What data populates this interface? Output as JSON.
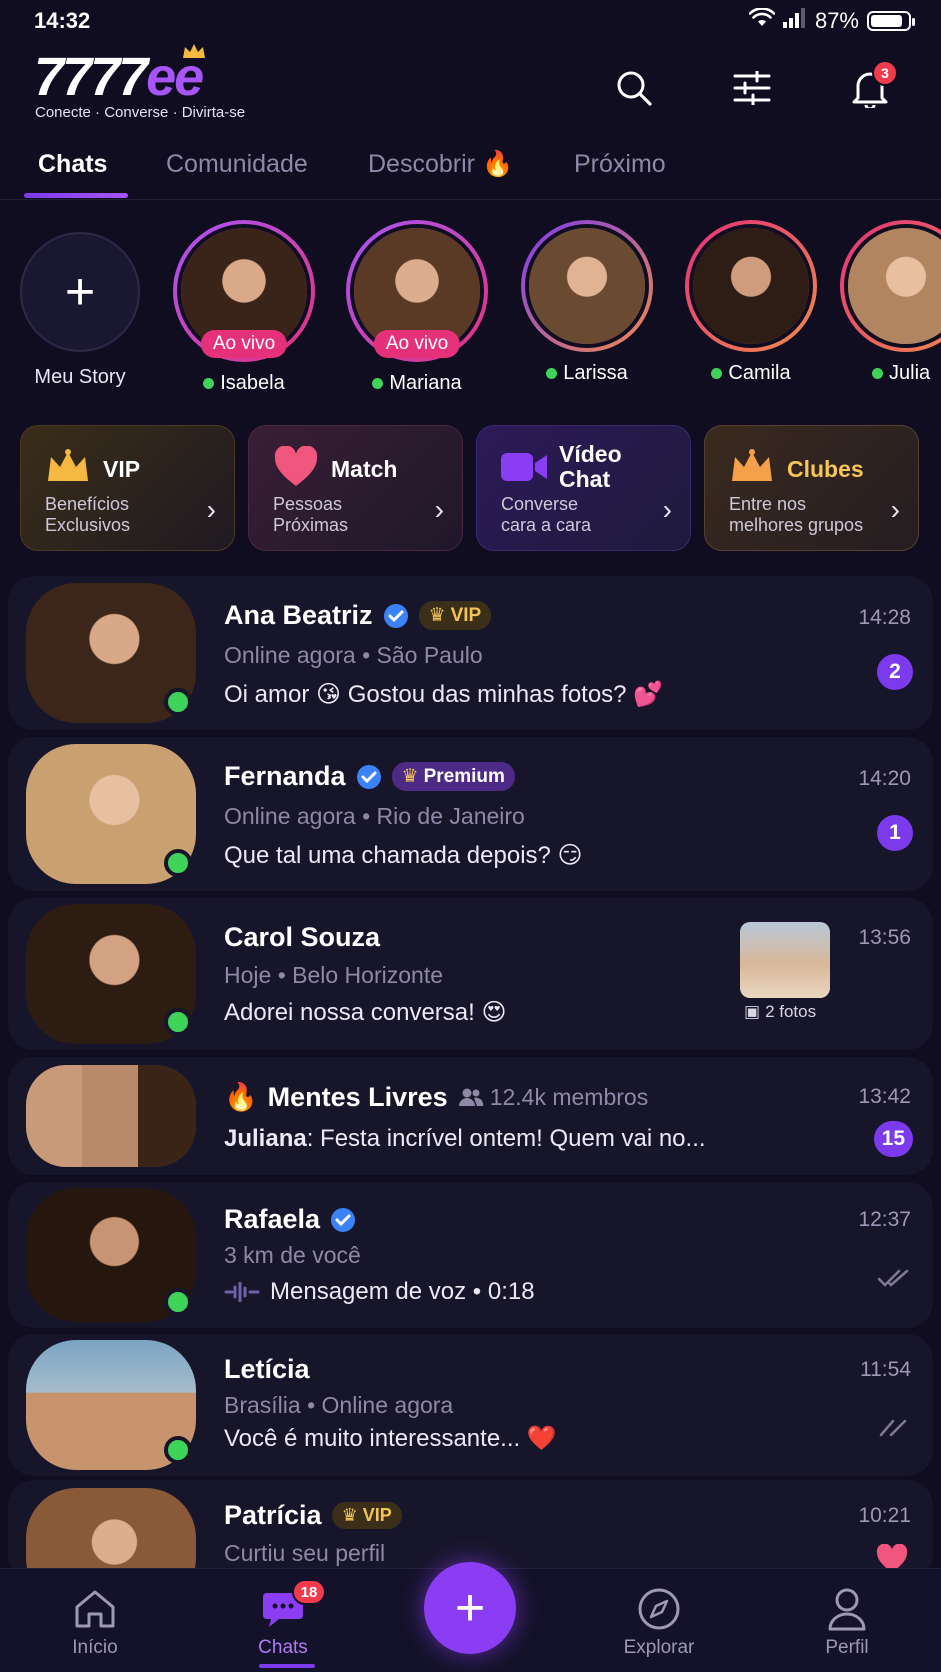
{
  "status": {
    "time": "14:32",
    "battery": "87%",
    "battery_level": 0.87
  },
  "header": {
    "logo_num": "7777",
    "logo_ee": "ee",
    "tagline": "Conecte · Converse · Divirta-se",
    "notification_count": "3"
  },
  "tabs": [
    {
      "label": "Chats"
    },
    {
      "label": "Comunidade"
    },
    {
      "label": "Descobrir"
    },
    {
      "label": "Próximo"
    }
  ],
  "stories": {
    "my_story_label": "Meu Story",
    "live_label": "Ao vivo",
    "items": [
      {
        "name": "Isabela"
      },
      {
        "name": "Mariana"
      },
      {
        "name": "Larissa"
      },
      {
        "name": "Camila"
      },
      {
        "name": "Julia"
      }
    ]
  },
  "features": [
    {
      "title": "VIP",
      "subtitle_1": "Benefícios",
      "subtitle_2": "Exclusivos"
    },
    {
      "title": "Match",
      "subtitle_1": "Pessoas",
      "subtitle_2": "Próximas"
    },
    {
      "title_1": "Vídeo",
      "title_2": "Chat",
      "subtitle_1": "Converse",
      "subtitle_2": "cara a cara"
    },
    {
      "title": "Clubes",
      "subtitle_1": "Entre nos",
      "subtitle_2": "melhores grupos"
    }
  ],
  "chats": [
    {
      "name": "Ana Beatriz",
      "badge": "VIP",
      "meta": "Online agora • São Paulo",
      "message": "Oi amor 😘 Gostou das minhas fotos? 💕",
      "time": "14:28",
      "unread": "2"
    },
    {
      "name": "Fernanda",
      "badge": "Premium",
      "meta": "Online agora • Rio de Janeiro",
      "message": "Que tal uma chamada depois? 😏",
      "time": "14:20",
      "unread": "1"
    },
    {
      "name": "Carol Souza",
      "meta": "Hoje • Belo Horizonte",
      "message": "Adorei nossa conversa! 😍",
      "time": "13:56",
      "photos": "2 fotos"
    },
    {
      "name": "Mentes Livres",
      "emoji": "🔥",
      "members": "12.4k membros",
      "sender": "Juliana",
      "message": ": Festa incrível ontem! Quem vai no...",
      "time": "13:42",
      "unread": "15"
    },
    {
      "name": "Rafaela",
      "meta": "3 km de você",
      "message": "Mensagem de voz • 0:18",
      "time": "12:37"
    },
    {
      "name": "Letícia",
      "meta": "Brasília • Online agora",
      "message": "Você é muito interessante... ❤️",
      "time": "11:54"
    },
    {
      "name": "Patrícia",
      "badge": "VIP",
      "meta": "Curtiu seu perfil",
      "time": "10:21"
    }
  ],
  "nav": {
    "home": "Início",
    "chats": "Chats",
    "chats_badge": "18",
    "explore": "Explorar",
    "profile": "Perfil"
  },
  "colors": {
    "accent": "#8b3df3",
    "background": "#0f0d1f",
    "online": "#3fd35a",
    "badge_red": "#ef3b4b",
    "gold": "#f3c45a"
  }
}
